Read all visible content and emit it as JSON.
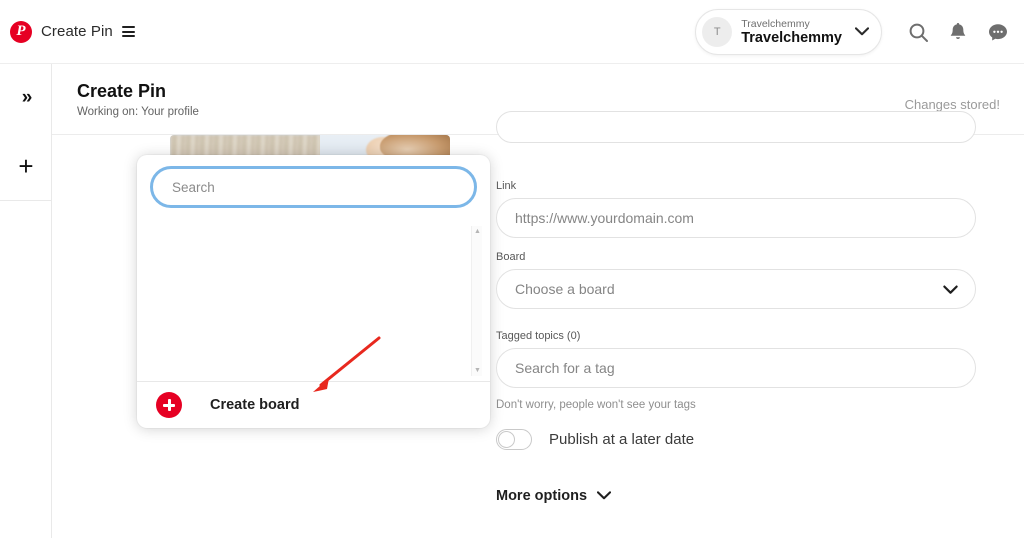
{
  "topbar": {
    "logo_icon": "pinterest-logo-icon",
    "logo_letter": "P",
    "brand_label": "Create Pin",
    "menu_icon": "hamburger-menu-icon",
    "account": {
      "avatar_initial": "T",
      "handle": "Travelchemmy",
      "name": "Travelchemmy",
      "caret_icon": "chevron-down-icon"
    },
    "icons": {
      "search": "search-icon",
      "notifications": "bell-icon",
      "messages": "message-bubble-icon"
    }
  },
  "rail": {
    "expand_icon": "chevrons-right-icon",
    "expand_glyph": "»",
    "add_icon": "plus-icon",
    "add_glyph": "+"
  },
  "pagehead": {
    "title": "Create Pin",
    "subtitle": "Working on: Your profile",
    "status": "Changes stored!"
  },
  "dropdown": {
    "search_placeholder": "Search",
    "search_value": "",
    "scroll_up_glyph": "▲",
    "scroll_down_glyph": "▼",
    "create_board_label": "Create board",
    "create_board_icon": "plus-circle-icon"
  },
  "annotation": {
    "arrow_color": "#e8281e",
    "arrow_name": "red-pointer-arrow"
  },
  "form": {
    "link": {
      "label": "Link",
      "placeholder": "https://www.yourdomain.com",
      "value": ""
    },
    "board": {
      "label": "Board",
      "placeholder": "Choose a board",
      "value": "",
      "caret_icon": "chevron-down-icon"
    },
    "tags": {
      "label": "Tagged topics (0)",
      "placeholder": "Search for a tag",
      "value": "",
      "helper": "Don't worry, people won't see your tags"
    },
    "publish_toggle": {
      "label": "Publish at a later date",
      "state": "off"
    },
    "more_options": {
      "label": "More options",
      "caret_icon": "chevron-down-icon"
    }
  },
  "colors": {
    "brand_red": "#e60023",
    "focus_blue": "#7cb7e8",
    "annotation_red": "#e8281e"
  }
}
